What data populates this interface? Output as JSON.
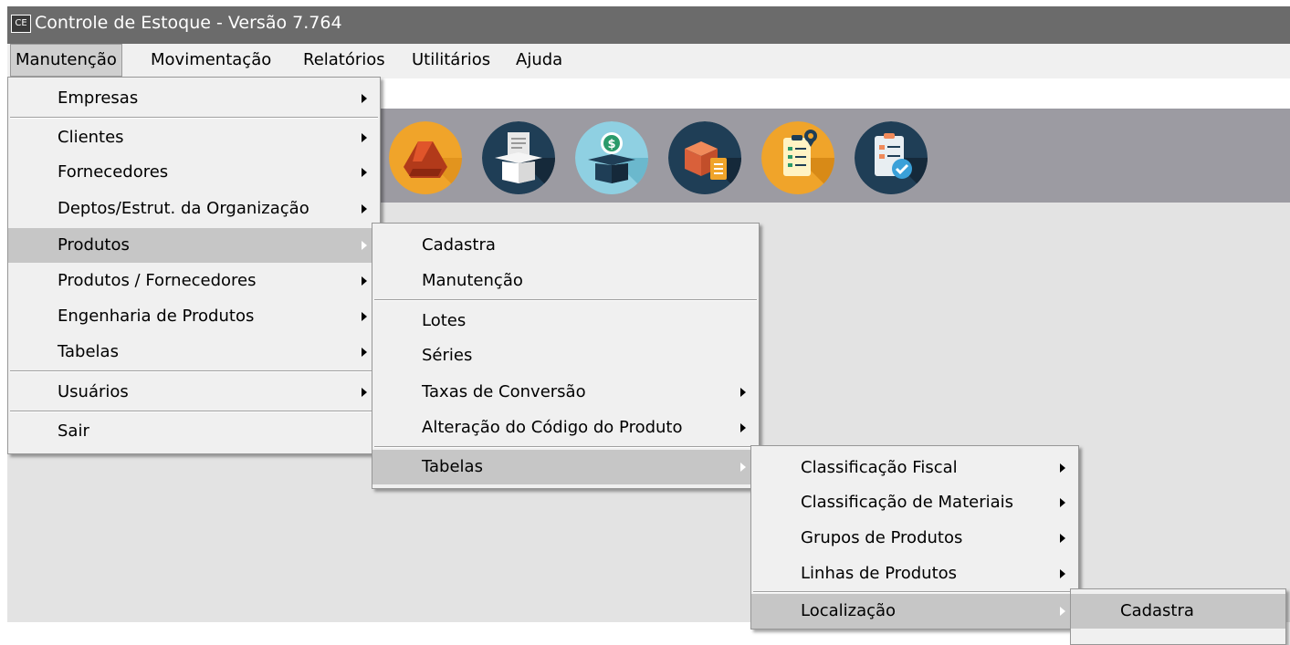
{
  "window": {
    "icon_label": "CE",
    "title": "Controle de Estoque - Versão 7.764"
  },
  "menubar": [
    {
      "label": "Manutenção",
      "active": true
    },
    {
      "label": "Movimentação"
    },
    {
      "label": "Relatórios"
    },
    {
      "label": "Utilitários"
    },
    {
      "label": "Ajuda"
    }
  ],
  "toolbar": {
    "buttons": [
      {
        "icon": "drive-triangle-icon",
        "color": "#f0a42a"
      },
      {
        "icon": "open-box-document-icon",
        "color": "#1f3e56"
      },
      {
        "icon": "money-box-icon",
        "color": "#8fd0e2"
      },
      {
        "icon": "boxes-checklist-icon",
        "color": "#1f3e56"
      },
      {
        "icon": "clipboard-location-icon",
        "color": "#f0a42a"
      },
      {
        "icon": "clipboard-check-icon",
        "color": "#1f3e56"
      }
    ]
  },
  "menus": {
    "manutencao": {
      "items": [
        {
          "label": "Empresas",
          "submenu": true
        },
        {
          "label": "Clientes",
          "submenu": true
        },
        {
          "label": "Fornecedores",
          "submenu": true
        },
        {
          "label": "Deptos/Estrut. da Organização",
          "submenu": true
        },
        {
          "label": "Produtos",
          "submenu": true,
          "highlighted": true
        },
        {
          "label": "Produtos / Fornecedores",
          "submenu": true
        },
        {
          "label": "Engenharia de Produtos",
          "submenu": true
        },
        {
          "label": "Tabelas",
          "submenu": true
        },
        {
          "label": "Usuários",
          "submenu": true
        },
        {
          "label": "Sair",
          "submenu": false
        }
      ]
    },
    "produtos": {
      "items": [
        {
          "label": "Cadastra",
          "submenu": false
        },
        {
          "label": "Manutenção",
          "submenu": false
        },
        {
          "label": "Lotes",
          "submenu": false
        },
        {
          "label": "Séries",
          "submenu": false
        },
        {
          "label": "Taxas de Conversão",
          "submenu": true
        },
        {
          "label": "Alteração do Código do Produto",
          "submenu": true
        },
        {
          "label": "Tabelas",
          "submenu": true,
          "highlighted": true
        }
      ]
    },
    "tabelas": {
      "items": [
        {
          "label": "Classificação Fiscal",
          "submenu": true
        },
        {
          "label": "Classificação de Materiais",
          "submenu": true
        },
        {
          "label": "Grupos de Produtos",
          "submenu": true
        },
        {
          "label": "Linhas de Produtos",
          "submenu": true
        },
        {
          "label": "Localização",
          "submenu": true,
          "highlighted": true
        }
      ]
    },
    "localizacao": {
      "items": [
        {
          "label": "Cadastra",
          "submenu": false,
          "highlighted": true
        }
      ]
    }
  }
}
